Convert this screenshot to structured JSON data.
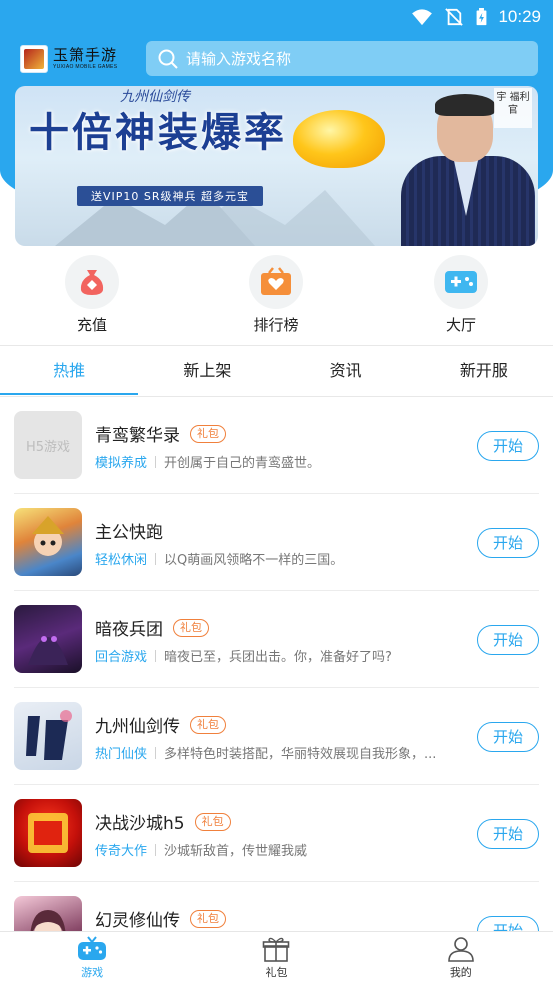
{
  "status_bar": {
    "time": "10:29",
    "icons": [
      "wifi-icon",
      "no-sim-icon",
      "battery-charging-icon"
    ]
  },
  "header": {
    "brand_name": "玉箫手游",
    "brand_sub": "YUXIAO MOBILE GAMES",
    "search_placeholder": "请输入游戏名称",
    "search_value": ""
  },
  "banner": {
    "logo_text": "九州仙剑传",
    "title": "十倍神装爆率",
    "subtitle": "送VIP10 SR级神兵 超多元宝",
    "stamp": "宇 福利 官"
  },
  "quick_actions": [
    {
      "label": "充值",
      "icon": "money-bag-icon",
      "color": "#f2645f"
    },
    {
      "label": "排行榜",
      "icon": "ranking-icon",
      "color": "#f58f3a"
    },
    {
      "label": "大厅",
      "icon": "gamepad-icon",
      "color": "#3fb7f0"
    }
  ],
  "tabs": [
    {
      "label": "热推",
      "active": true
    },
    {
      "label": "新上架",
      "active": false
    },
    {
      "label": "资讯",
      "active": false
    },
    {
      "label": "新开服",
      "active": false
    }
  ],
  "games": [
    {
      "name": "青鸾繁华录",
      "gift": "礼包",
      "category": "模拟养成",
      "desc": "开创属于自己的青鸾盛世。",
      "thumb_text": "H5游戏",
      "button": "开始"
    },
    {
      "name": "主公快跑",
      "gift": "",
      "category": "轻松休闲",
      "desc": "以Q萌画风领略不一样的三国。",
      "thumb_text": "",
      "button": "开始"
    },
    {
      "name": "暗夜兵团",
      "gift": "礼包",
      "category": "回合游戏",
      "desc": "暗夜已至，兵团出击。你，准备好了吗?",
      "thumb_text": "",
      "button": "开始"
    },
    {
      "name": "九州仙剑传",
      "gift": "礼包",
      "category": "热门仙侠",
      "desc": "多样特色时装搭配，华丽特效展现自我形象，...",
      "thumb_text": "",
      "button": "开始"
    },
    {
      "name": "决战沙城h5",
      "gift": "礼包",
      "category": "传奇大作",
      "desc": "沙城斩敌首，传世耀我威",
      "thumb_text": "",
      "button": "开始"
    },
    {
      "name": "幻灵修仙传",
      "gift": "礼包",
      "category": "",
      "desc": "",
      "thumb_text": "",
      "button": "开始"
    }
  ],
  "bottom_nav": [
    {
      "label": "游戏",
      "icon": "gamepad-icon",
      "active": true
    },
    {
      "label": "礼包",
      "icon": "gift-box-icon",
      "active": false
    },
    {
      "label": "我的",
      "icon": "user-icon",
      "active": false
    }
  ],
  "colors": {
    "accent": "#2aa7ee",
    "gift": "#f0803c"
  }
}
